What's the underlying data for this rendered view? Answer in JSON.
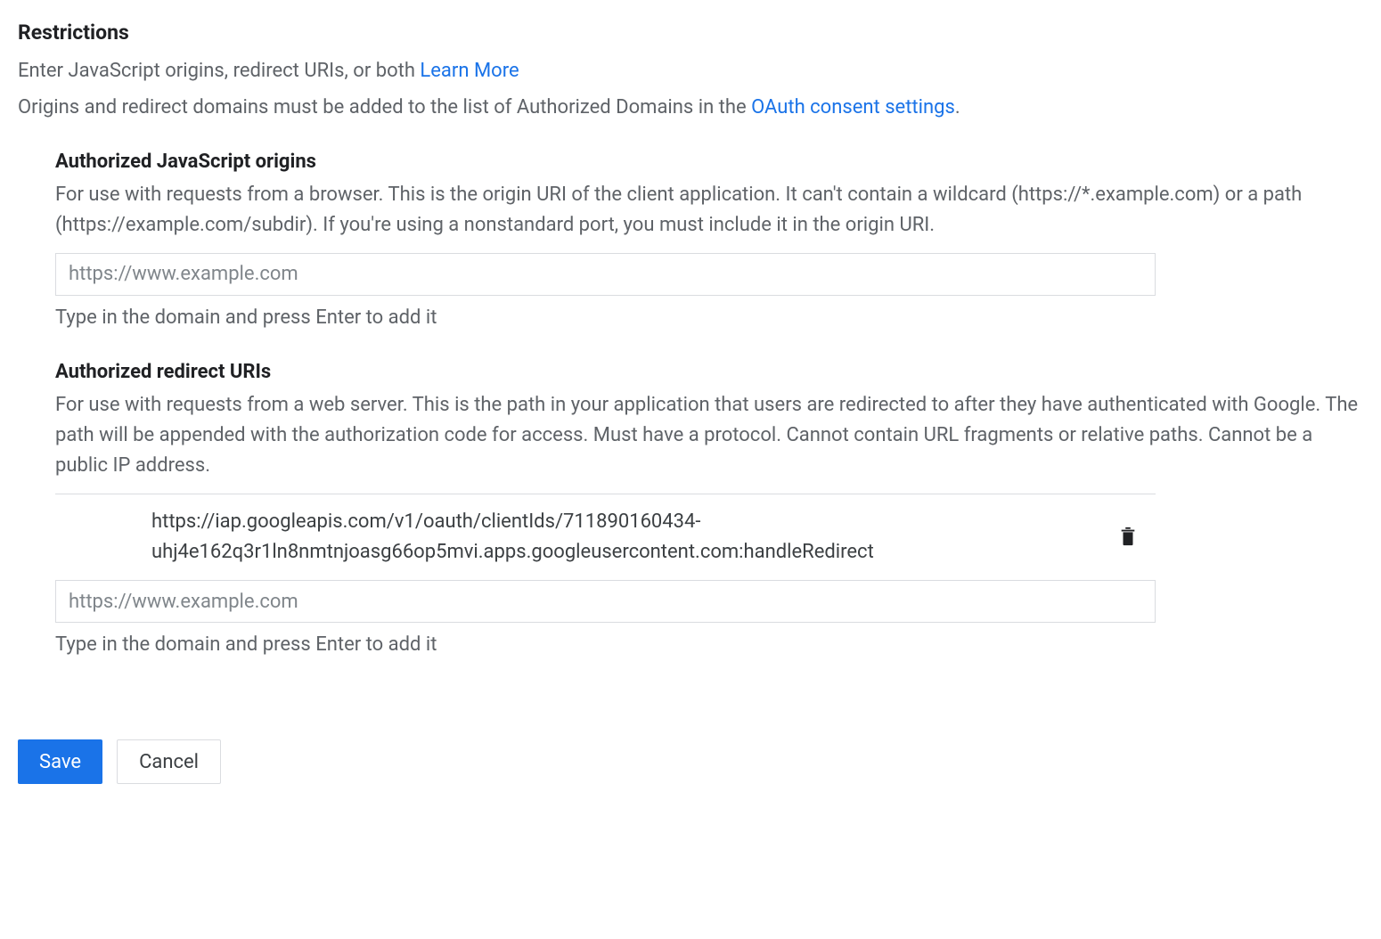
{
  "restrictions": {
    "title": "Restrictions",
    "desc_prefix": "Enter JavaScript origins, redirect URIs, or both ",
    "learn_more": "Learn More",
    "domains_note_prefix": "Origins and redirect domains must be added to the list of Authorized Domains in the ",
    "oauth_link": "OAuth consent settings",
    "period": "."
  },
  "js_origins": {
    "title": "Authorized JavaScript origins",
    "desc": "For use with requests from a browser. This is the origin URI of the client application. It can't contain a wildcard (https://*.example.com) or a path (https://example.com/subdir). If you're using a nonstandard port, you must include it in the origin URI.",
    "placeholder": "https://www.example.com",
    "helper": "Type in the domain and press Enter to add it"
  },
  "redirect_uris": {
    "title": "Authorized redirect URIs",
    "desc": "For use with requests from a web server. This is the path in your application that users are redirected to after they have authenticated with Google. The path will be appended with the authorization code for access. Must have a protocol. Cannot contain URL fragments or relative paths. Cannot be a public IP address.",
    "entries": [
      "https://iap.googleapis.com/v1/oauth/clientIds/711890160434-uhj4e162q3r1ln8nmtnjoasg66op5mvi.apps.googleusercontent.com:handleRedirect"
    ],
    "placeholder": "https://www.example.com",
    "helper": "Type in the domain and press Enter to add it"
  },
  "buttons": {
    "save": "Save",
    "cancel": "Cancel"
  }
}
